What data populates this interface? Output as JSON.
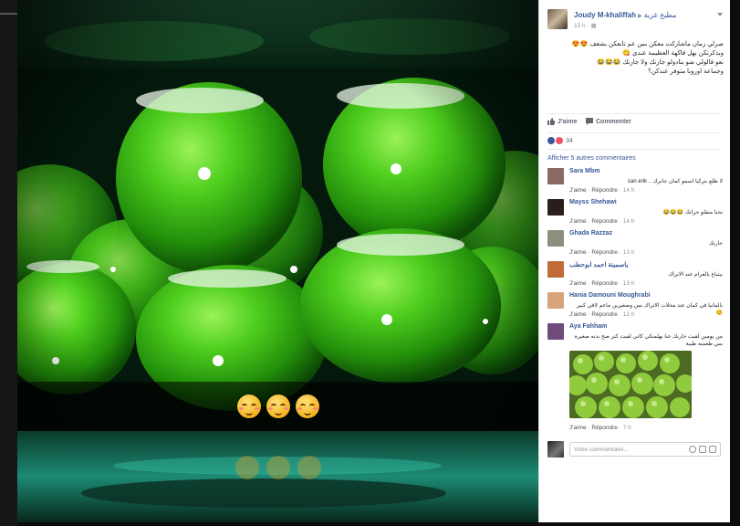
{
  "photo": {
    "caption_emojis": [
      "kissing-face-icon",
      "kissing-face-icon",
      "kissing-face-icon"
    ]
  },
  "post": {
    "author": "Joudy M-khaliffah",
    "group": "مطبخ غربة",
    "time": "15 h",
    "lines": [
      "صرلي زمان ماشاركت معكن بس عم تابعكن بشغف 😍😍",
      "وبذكرتكن بهل فاكهة العظيمة عندي 😋",
      "نعو قالولي شو بتادولو جارنك ولا جارنك 😂😂😂",
      "وجماعة اوروبا متوفر عندكن؟"
    ],
    "like_label": "J'aime",
    "comment_label": "Commenter",
    "reaction_count": "34",
    "more_comments": "Afficher 5 autres commentaires"
  },
  "comments": [
    {
      "name": "Sara Mbm",
      "text": "لا طلع بتركيا اسمو كمان جانرك .. can erik",
      "like": "J'aime",
      "reply": "Répondre",
      "time": "14 h",
      "avatar_color": "#8a6a63"
    },
    {
      "name": "Mayss Shehawi",
      "text": "نحنا منقلو جرانك 😂😂😂",
      "like": "J'aime",
      "reply": "Répondre",
      "time": "14 h",
      "avatar_color": "#2b1e1a"
    },
    {
      "name": "Ghada Razzaz",
      "text": "جارنك",
      "like": "J'aime",
      "reply": "Répondre",
      "time": "13 h",
      "avatar_color": "#8b8f7e"
    },
    {
      "name": "ياسمينة احمد ابوحطب",
      "text": "بيتباع بالعرام عند الاتراك",
      "like": "J'aime",
      "reply": "Répondre",
      "time": "13 h",
      "avatar_color": "#c26b3a"
    },
    {
      "name": "Hania Damouni Moughrabi",
      "text": "بالمانيا في كمان عند محلات الاتراك بس وصغيرين ماعم لاقي كبير 😊",
      "like": "J'aime",
      "reply": "Répondre",
      "time": "12 h",
      "avatar_color": "#d9a37a"
    },
    {
      "name": "Aya Fahham",
      "text": "من يومين لقيت جارنك عنا بهلمنكي كاتي لقيت كتر صح بدنه صغيرة بس طعمته طيبة",
      "like": "J'aime",
      "reply": "Répondre",
      "time": "7 h",
      "avatar_color": "#6f4a7b"
    }
  ],
  "composer": {
    "placeholder": "Votre commentaire..."
  },
  "colors": {
    "link": "#365899",
    "panel_bg": "#ffffff",
    "photo_bg": "#05140a",
    "fruit_green": "#3fb51b"
  }
}
